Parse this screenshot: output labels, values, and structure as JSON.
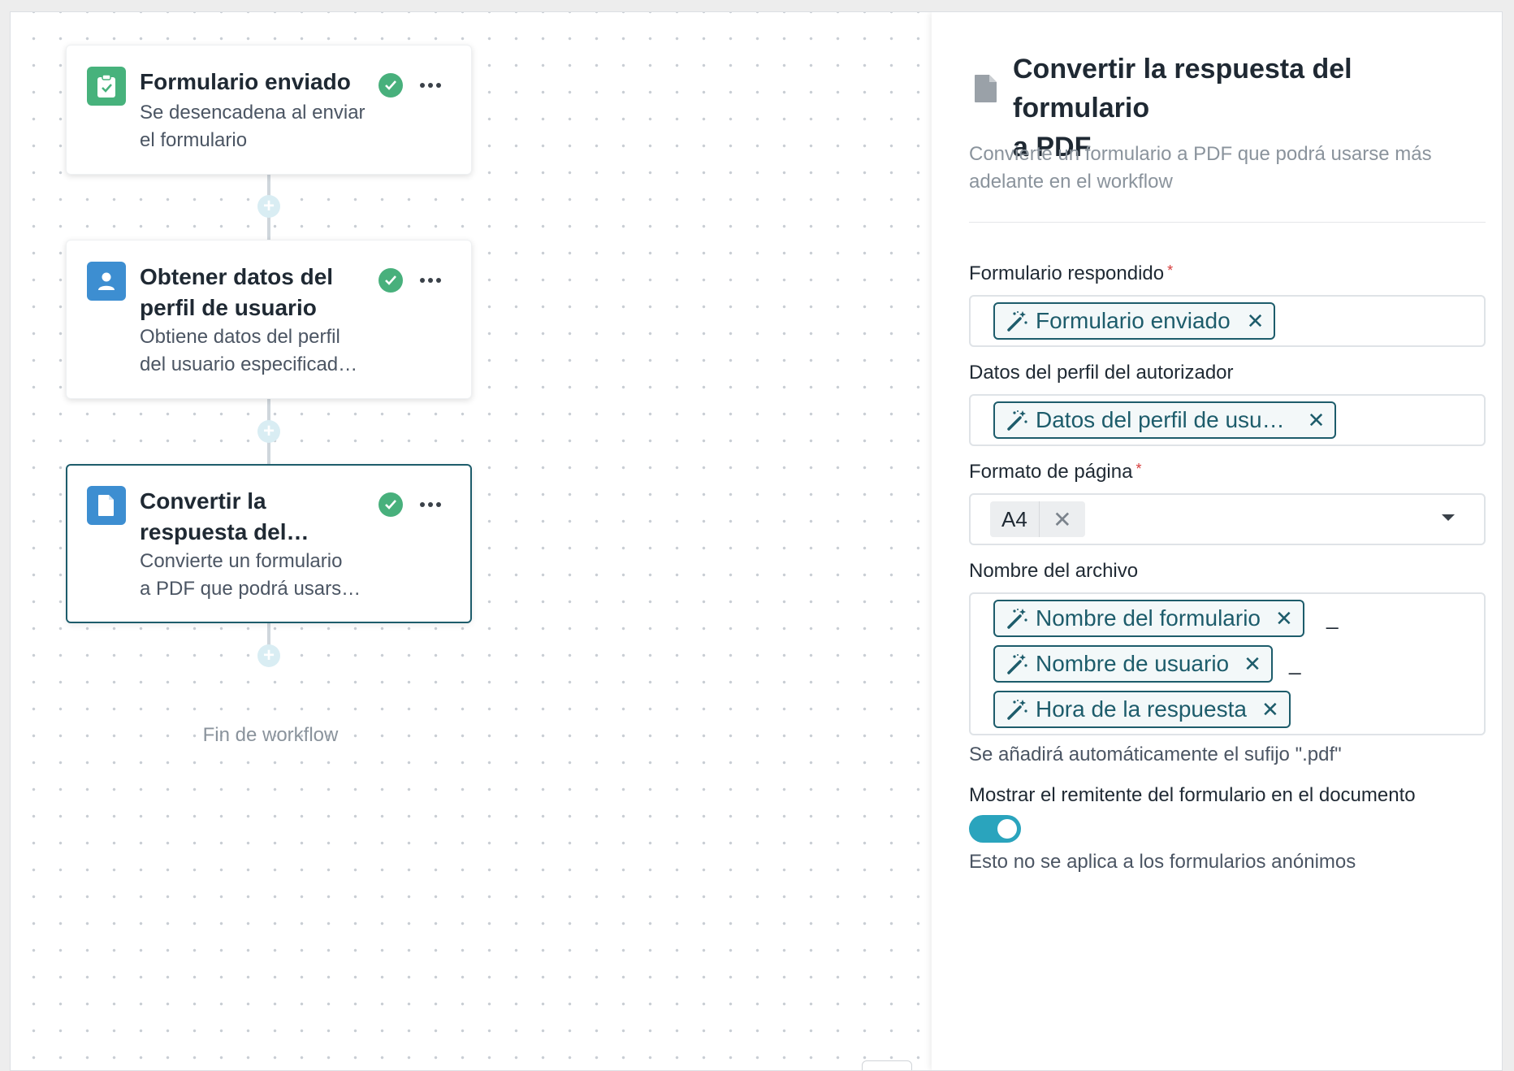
{
  "workflow": {
    "steps": [
      {
        "title": "Formulario enviado",
        "description_lines": [
          "Se desencadena al enviar",
          "el formulario"
        ],
        "icon": "clipboard-check-icon",
        "icon_color": "#47b27c",
        "status": "complete"
      },
      {
        "title_lines": [
          "Obtener datos del",
          "perfil de usuario"
        ],
        "description_lines": [
          "Obtiene datos del perfil",
          "del usuario especificad…"
        ],
        "icon": "user-icon",
        "icon_color": "#3d8ed1",
        "status": "complete"
      },
      {
        "title_lines": [
          "Convertir la",
          "respuesta del…"
        ],
        "description_lines": [
          "Convierte un formulario",
          "a PDF que podrá usars…"
        ],
        "icon": "document-icon",
        "icon_color": "#3d8ed1",
        "status": "complete",
        "selected": true
      }
    ],
    "end_label": "Fin de workflow"
  },
  "panel": {
    "title_lines": [
      "Convertir la respuesta del formulario",
      "a PDF"
    ],
    "description_lines": [
      "Convierte un formulario a PDF que podrá usarse más",
      "adelante en el workflow"
    ],
    "fields": {
      "form": {
        "label": "Formulario respondido",
        "required_mark": "*",
        "chips": [
          "Formulario enviado"
        ]
      },
      "profile": {
        "label": "Datos del perfil del autorizador",
        "chips": [
          "Datos del perfil de usu…"
        ]
      },
      "page_format": {
        "label": "Formato de página",
        "required_mark": "*",
        "selected": "A4"
      },
      "filename": {
        "label": "Nombre del archivo",
        "chips": [
          "Nombre del formulario",
          "Nombre de usuario",
          "Hora de la respuesta"
        ],
        "separator": "_",
        "hint": "Se añadirá automáticamente el sufijo \".pdf\""
      },
      "show_sender": {
        "label": "Mostrar el remitente del formulario en el documento",
        "enabled": true,
        "hint": "Esto no se aplica a los formularios anónimos"
      }
    }
  },
  "colors": {
    "accent": "#1d5c6b",
    "toggle_on": "#2aa4bd",
    "success": "#48b07c",
    "required": "#d63a3a"
  }
}
